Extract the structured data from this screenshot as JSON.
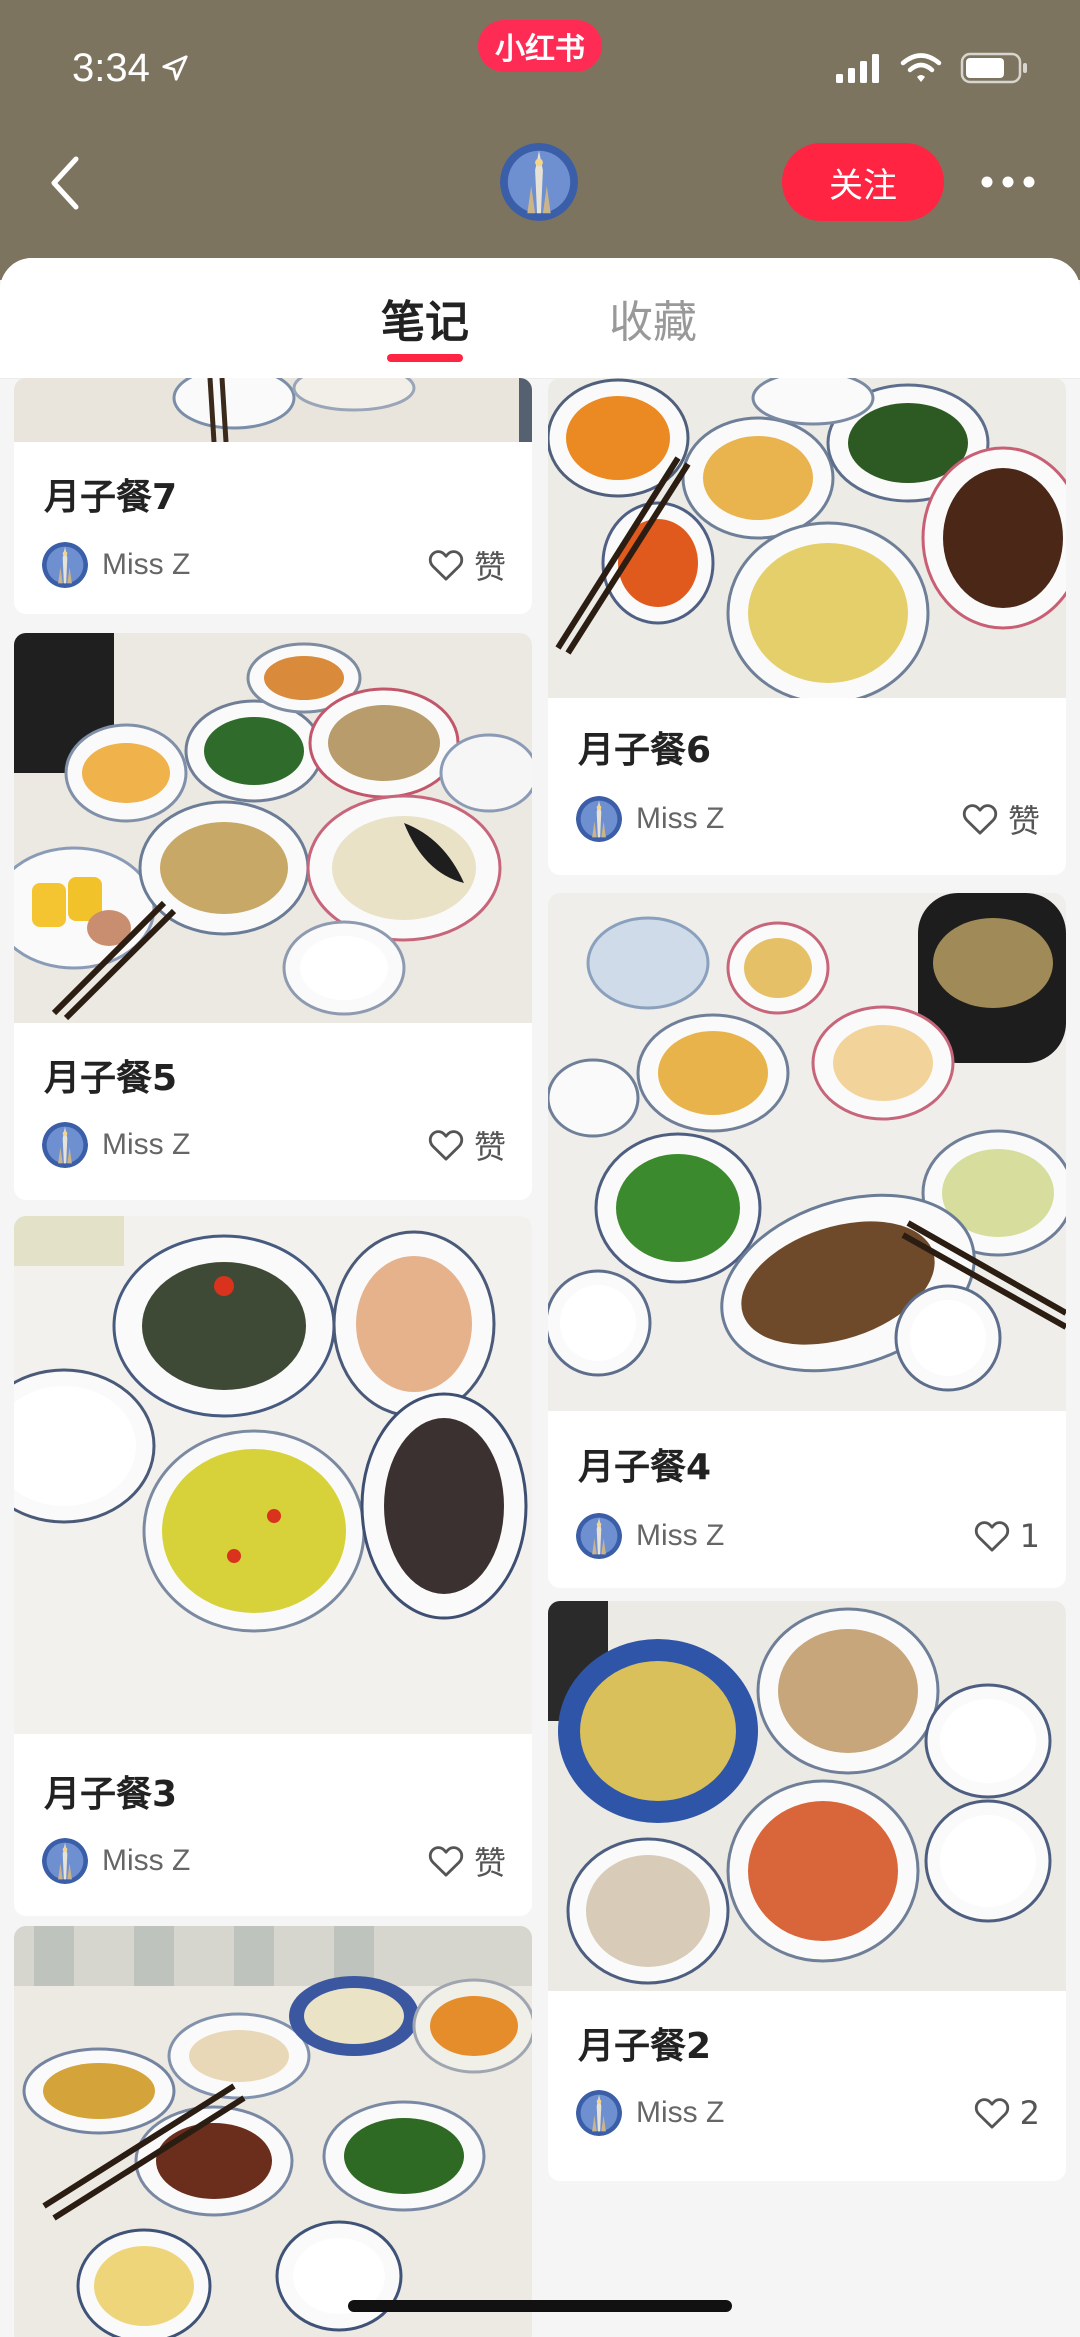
{
  "status_bar": {
    "time": "3:34",
    "app_badge": "小红书"
  },
  "header": {
    "follow_label": "关注"
  },
  "tabs": [
    {
      "label": "笔记",
      "active": true
    },
    {
      "label": "收藏",
      "active": false
    }
  ],
  "colors": {
    "header_bg": "#7d7460",
    "accent": "#ff2442"
  },
  "notes": [
    {
      "title": "月子餐7",
      "author": "Miss Z",
      "likes": "赞"
    },
    {
      "title": "月子餐6",
      "author": "Miss Z",
      "likes": "赞"
    },
    {
      "title": "月子餐5",
      "author": "Miss Z",
      "likes": "赞"
    },
    {
      "title": "月子餐4",
      "author": "Miss Z",
      "likes": "1"
    },
    {
      "title": "月子餐3",
      "author": "Miss Z",
      "likes": "赞"
    },
    {
      "title": "月子餐2",
      "author": "Miss Z",
      "likes": "2"
    }
  ]
}
